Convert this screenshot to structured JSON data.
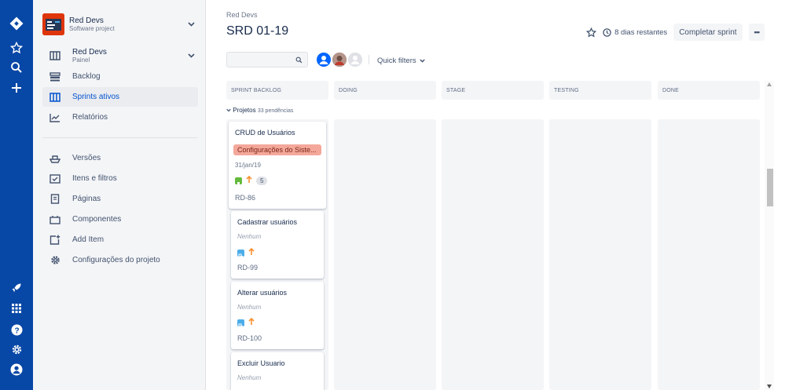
{
  "global_nav": {
    "items": [
      {
        "name": "jira-logo-icon"
      },
      {
        "name": "star-icon"
      },
      {
        "name": "search-icon"
      },
      {
        "name": "plus-icon"
      },
      {
        "name": "rocket-icon"
      },
      {
        "name": "apps-grid-icon"
      },
      {
        "name": "help-icon"
      },
      {
        "name": "settings-icon"
      },
      {
        "name": "profile-icon"
      }
    ]
  },
  "sidebar": {
    "project": {
      "name": "Red Devs",
      "type": "Software project"
    },
    "board": {
      "name": "Red Devs",
      "type": "Painel"
    },
    "items": [
      {
        "label": "Backlog",
        "icon": "backlog-icon"
      },
      {
        "label": "Sprints ativos",
        "icon": "board-icon",
        "active": true
      },
      {
        "label": "Relatórios",
        "icon": "reports-icon"
      },
      {
        "label": "Versões",
        "icon": "ship-icon"
      },
      {
        "label": "Itens e filtros",
        "icon": "filter-icon"
      },
      {
        "label": "Páginas",
        "icon": "page-icon"
      },
      {
        "label": "Componentes",
        "icon": "component-icon"
      },
      {
        "label": "Add Item",
        "icon": "add-item-icon"
      },
      {
        "label": "Configurações do projeto",
        "icon": "gear-icon"
      }
    ]
  },
  "header": {
    "breadcrumb": "Red Devs",
    "title": "SRD 01-19",
    "days_remaining": "8 dias restantes",
    "complete_sprint": "Completar sprint",
    "more": "•••"
  },
  "toolbar": {
    "search_placeholder": "",
    "quick_filters": "Quick filters"
  },
  "columns": [
    "SPRINT BACKLOG",
    "DOING",
    "STAGE",
    "TESTING",
    "DONE"
  ],
  "swimlane": {
    "label": "Projetos",
    "count": "33 pendências"
  },
  "cards": [
    {
      "title": "CRUD de Usuários",
      "epic": "Configurações do Siste...",
      "date": "31/jan/19",
      "estimate": "5",
      "key": "RD-86",
      "type": "story"
    },
    {
      "title": "Cadastrar usuários",
      "subtitle": "Nenhum",
      "key": "RD-99",
      "type": "subtask"
    },
    {
      "title": "Alterar usuários",
      "subtitle": "Nenhum",
      "key": "RD-100",
      "type": "subtask"
    },
    {
      "title": "Excluir Usuario",
      "subtitle": "Nenhum",
      "type": "subtask"
    }
  ],
  "colors": {
    "nav": "#0747a6",
    "active": "#0052cc",
    "epic": "#f4a89b",
    "story": "#63ba3c",
    "subtask": "#4bade8",
    "priority": "#f79232"
  }
}
